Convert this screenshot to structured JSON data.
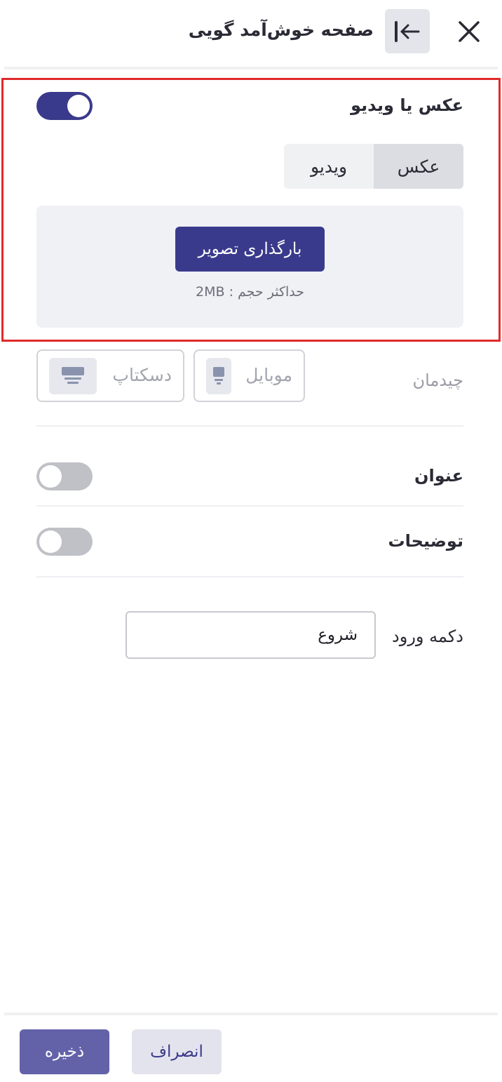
{
  "header": {
    "title": "صفحه خوش‌آمد گویی",
    "close_icon": "close-icon",
    "collapse_icon": "collapse-left-arrow-icon"
  },
  "media_section": {
    "label": "عکس یا ویدیو",
    "toggle_on": true,
    "tabs": [
      {
        "label": "عکس",
        "active": true
      },
      {
        "label": "ویدیو",
        "active": false
      }
    ],
    "upload_button_label": "بارگذاری تصویر",
    "upload_hint": "حداکثر حجم : 2MB"
  },
  "layout": {
    "label": "چیدمان",
    "options": [
      {
        "label": "موبایل",
        "icon": "mobile-icon"
      },
      {
        "label": "دسکتاپ",
        "icon": "desktop-icon"
      }
    ]
  },
  "title_row": {
    "label": "عنوان",
    "toggle_on": false
  },
  "description_row": {
    "label": "توضیحات",
    "toggle_on": false
  },
  "entry_button": {
    "label": "دکمه ورود",
    "value": "شروع"
  },
  "footer": {
    "save_label": "ذخیره",
    "cancel_label": "انصراف"
  },
  "colors": {
    "primary": "#3a3a8c",
    "save_button": "#6362a9",
    "highlight_border": "#e02a2a"
  }
}
